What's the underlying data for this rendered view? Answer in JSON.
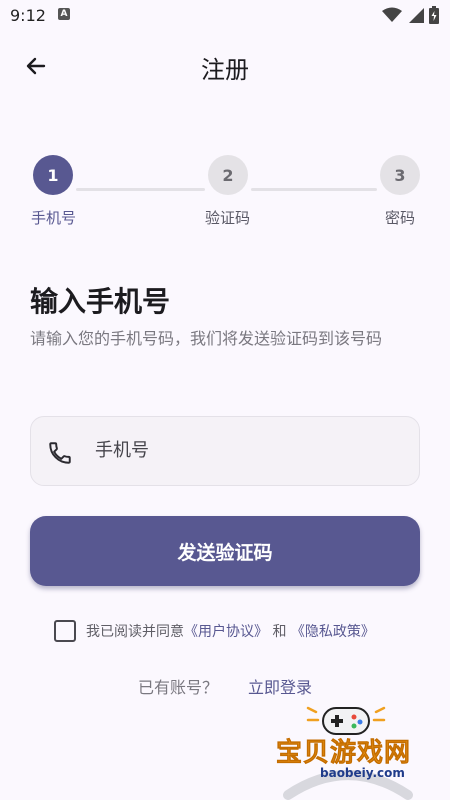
{
  "status_bar": {
    "time": "9:12",
    "notif_badge": "A"
  },
  "app_bar": {
    "title": "注册"
  },
  "stepper": {
    "steps": [
      {
        "number": "1",
        "label": "手机号"
      },
      {
        "number": "2",
        "label": "验证码"
      },
      {
        "number": "3",
        "label": "密码"
      }
    ]
  },
  "form": {
    "headline": "输入手机号",
    "subtext": "请输入您的手机号码，我们将发送验证码到该号码",
    "phone_placeholder": "手机号",
    "phone_value": "",
    "send_button_label": "发送验证码"
  },
  "agreement": {
    "checked": false,
    "prefix": "我已阅读并同意",
    "user_agreement": "《用户协议》",
    "conjunction": " 和 ",
    "privacy_policy": "《隐私政策》"
  },
  "login": {
    "prompt": "已有账号？",
    "link": "立即登录"
  },
  "watermark": {
    "title": "宝贝游戏网",
    "url": "baobeiy.com"
  },
  "colors": {
    "primary": "#585891",
    "background": "#fbf8fe",
    "step_inactive": "#e4e2e6"
  }
}
